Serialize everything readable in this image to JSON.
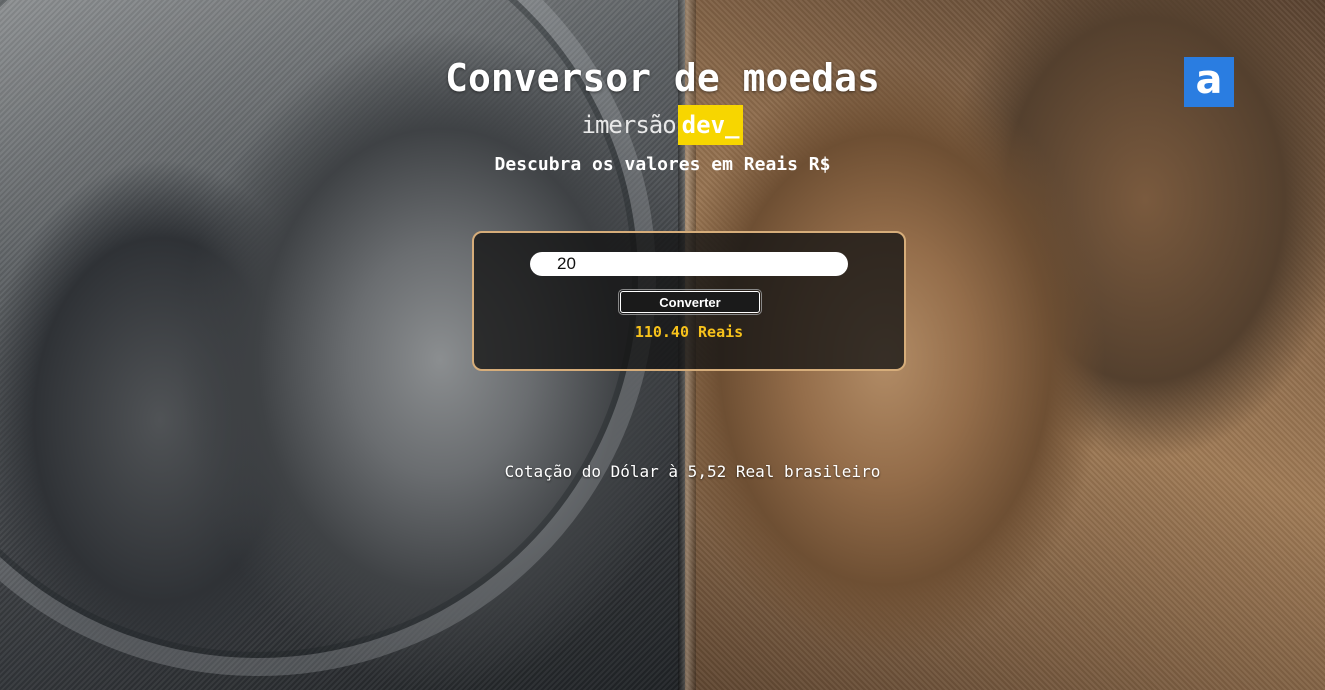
{
  "header": {
    "title": "Conversor de moedas",
    "brand_light": "imersão",
    "brand_highlight": "dev_",
    "subtitle": "Descubra os valores em Reais R$"
  },
  "logo": {
    "glyph": "a",
    "icon": "alura-logo-icon",
    "color": "#2a7de1"
  },
  "converter": {
    "input_value": "20",
    "button_label": "Converter",
    "result_text": "110.40 Reais",
    "border_color": "#d6ad7a",
    "result_color": "#f7c21b"
  },
  "footer": {
    "rate_text": "Cotação do Dólar à 5,52 Real brasileiro"
  },
  "colors": {
    "brand_highlight_bg": "#f7d600"
  }
}
